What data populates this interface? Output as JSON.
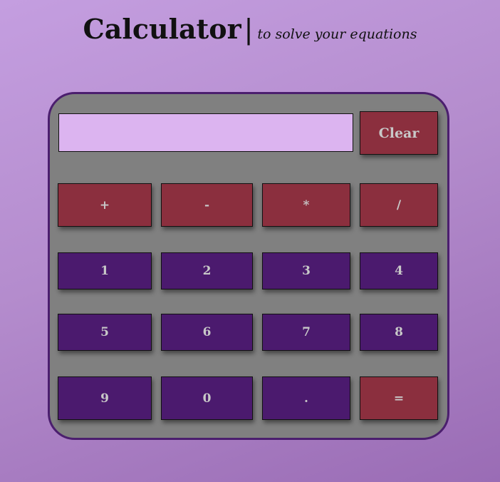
{
  "header": {
    "title": "Calculator",
    "divider": "|",
    "subtitle": "to solve your equations"
  },
  "display": {
    "value": ""
  },
  "buttons": {
    "clear": "Clear",
    "plus": "+",
    "minus": "-",
    "multiply": "*",
    "divide": "/",
    "one": "1",
    "two": "2",
    "three": "3",
    "four": "4",
    "five": "5",
    "six": "6",
    "seven": "7",
    "eight": "8",
    "nine": "9",
    "zero": "0",
    "dot": ".",
    "equals": "="
  },
  "colors": {
    "operator_button": "#8b2f3e",
    "digit_button": "#4b1a6e",
    "display_background": "#dcb4f0",
    "calculator_body": "#808080",
    "calculator_border": "#4b1e6e"
  }
}
